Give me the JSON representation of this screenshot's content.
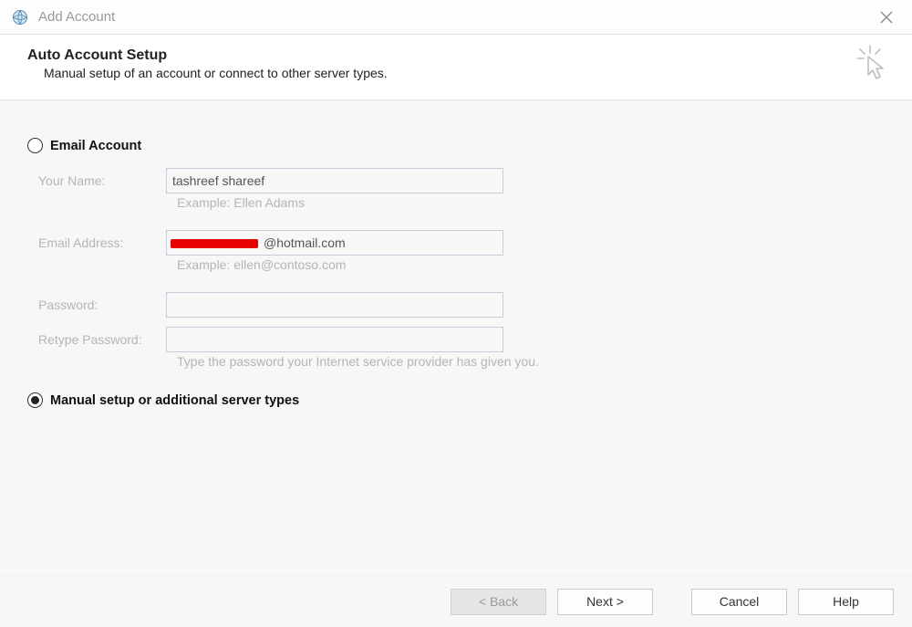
{
  "window": {
    "title": "Add Account"
  },
  "header": {
    "heading": "Auto Account Setup",
    "subheading": "Manual setup of an account or connect to other server types."
  },
  "options": {
    "email_account_label": "Email Account",
    "manual_setup_label": "Manual setup or additional server types"
  },
  "form": {
    "your_name": {
      "label": "Your Name:",
      "value": "tashreef shareef",
      "hint": "Example: Ellen Adams"
    },
    "email": {
      "label": "Email Address:",
      "value_visible": "@hotmail.com",
      "hint": "Example: ellen@contoso.com"
    },
    "password": {
      "label": "Password:"
    },
    "retype_password": {
      "label": "Retype Password:"
    },
    "password_hint": "Type the password your Internet service provider has given you."
  },
  "footer": {
    "back": "< Back",
    "next": "Next >",
    "cancel": "Cancel",
    "help": "Help"
  }
}
